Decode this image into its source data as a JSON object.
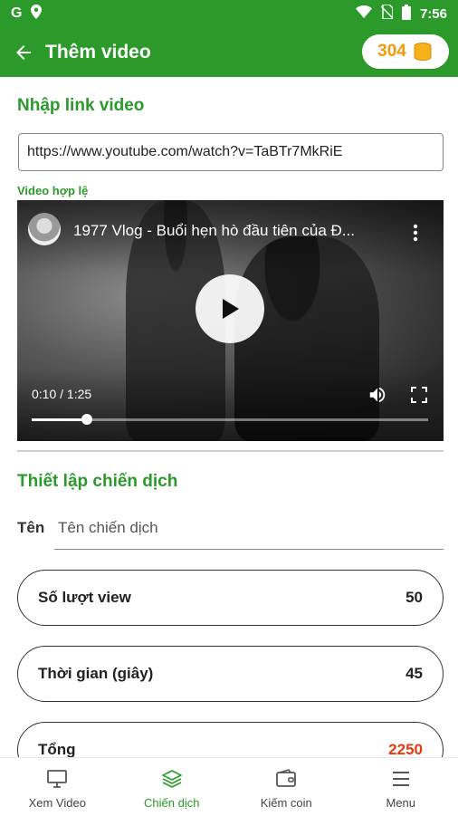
{
  "status_bar": {
    "time": "7:56",
    "left_icon_letter": "G",
    "icons": [
      "google-icon",
      "location-icon",
      "wifi-icon",
      "no-sim-icon",
      "battery-icon"
    ]
  },
  "app_bar": {
    "title": "Thêm video",
    "coin_count": "304",
    "coin_color": "#f29a0c",
    "brand_color": "#2b9a2b"
  },
  "link_section": {
    "title": "Nhập link video",
    "url_value": "https://www.youtube.com/watch?v=TaBTr7MkRiE",
    "valid_label": "Video hợp lệ"
  },
  "video_player": {
    "title": "1977 Vlog - Buổi hẹn hò đầu tiên của Đ...",
    "time": "0:10 / 1:25",
    "progress": 0.14
  },
  "campaign_section": {
    "title": "Thiết lập chiến dịch",
    "name_label": "Tên",
    "name_placeholder": "Tên chiến dịch",
    "fields": [
      {
        "label": "Số lượt view",
        "value": "50"
      },
      {
        "label": "Thời gian (giây)",
        "value": "45"
      },
      {
        "label": "Tổng",
        "value": "2250",
        "value_color": "#e8380f"
      }
    ]
  },
  "bottom_nav": {
    "items": [
      {
        "label": "Xem Video",
        "icon": "monitor-icon"
      },
      {
        "label": "Chiến dịch",
        "icon": "layers-icon",
        "active": true
      },
      {
        "label": "Kiếm coin",
        "icon": "wallet-icon"
      },
      {
        "label": "Menu",
        "icon": "hamburger-icon"
      }
    ]
  }
}
